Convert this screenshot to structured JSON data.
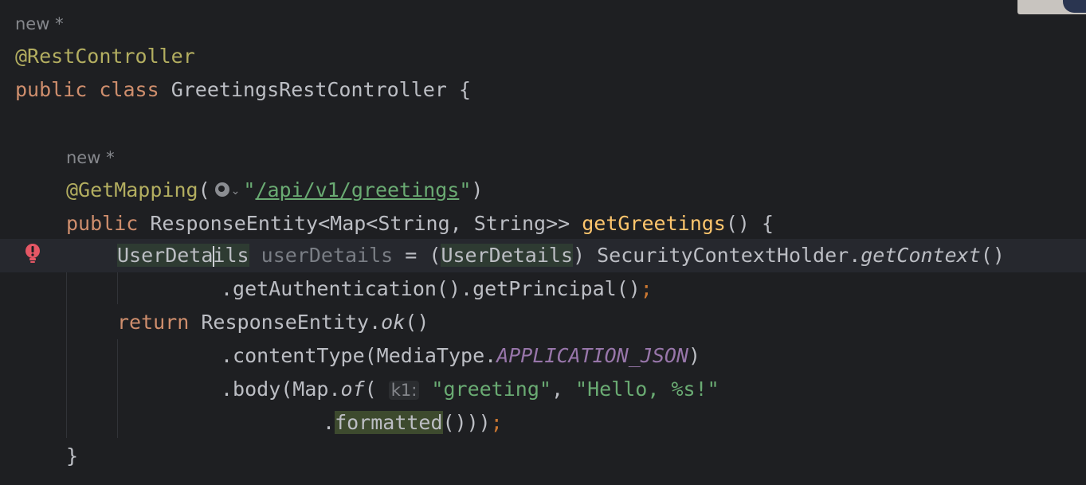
{
  "editor": {
    "author_hint_class": "new *",
    "author_hint_method": "new *",
    "class_annotation": "@RestController",
    "class_decl": {
      "kw_public": "public",
      "kw_class": "class",
      "name": "GreetingsRestController",
      "brace": "{"
    },
    "mapping": {
      "name": "@GetMapping",
      "open": "(",
      "q1": "\"",
      "path": "/api/v1/greetings",
      "q2": "\"",
      "close": ")"
    },
    "method": {
      "kw_public": "public",
      "type": "ResponseEntity<Map<String, String>>",
      "name": "getGreetings",
      "rest": "() {"
    },
    "line_assign": {
      "type_start": "UserDeta",
      "type_end": "ils",
      "var": "userDetails",
      "mid": " = (",
      "cast": "UserDetails",
      "after_cast": ") SecurityContextHolder.",
      "call": "getContext",
      "end": "()"
    },
    "line_chain": {
      "text": ".getAuthentication().getPrincipal()",
      "semi": ";"
    },
    "line_return": {
      "kw": "return",
      "obj": "ResponseEntity.",
      "call": "ok",
      "end": "()"
    },
    "line_content": {
      "start": ".contentType(MediaType.",
      "const": "APPLICATION_JSON",
      "end": ")"
    },
    "line_body": {
      "start": ".body(Map.",
      "call": "of",
      "open": "(",
      "param_hint": "k1:",
      "s1": "\"greeting\"",
      "comma": ", ",
      "s2": "\"Hello, %s!\""
    },
    "line_formatted": {
      "dot": ".",
      "call": "formatted",
      "end": "()))",
      "semi": ";"
    },
    "closing_brace": "}"
  },
  "colors": {
    "background": "#1e1f22",
    "keyword": "#cf8e6d",
    "annotation": "#b3ae60",
    "method": "#ffc66d",
    "string": "#6aab73",
    "constant": "#9876aa",
    "error_bulb": "#e55765"
  },
  "icons": [
    "error-bulb-icon",
    "globe-icon",
    "chevron-down-icon"
  ]
}
